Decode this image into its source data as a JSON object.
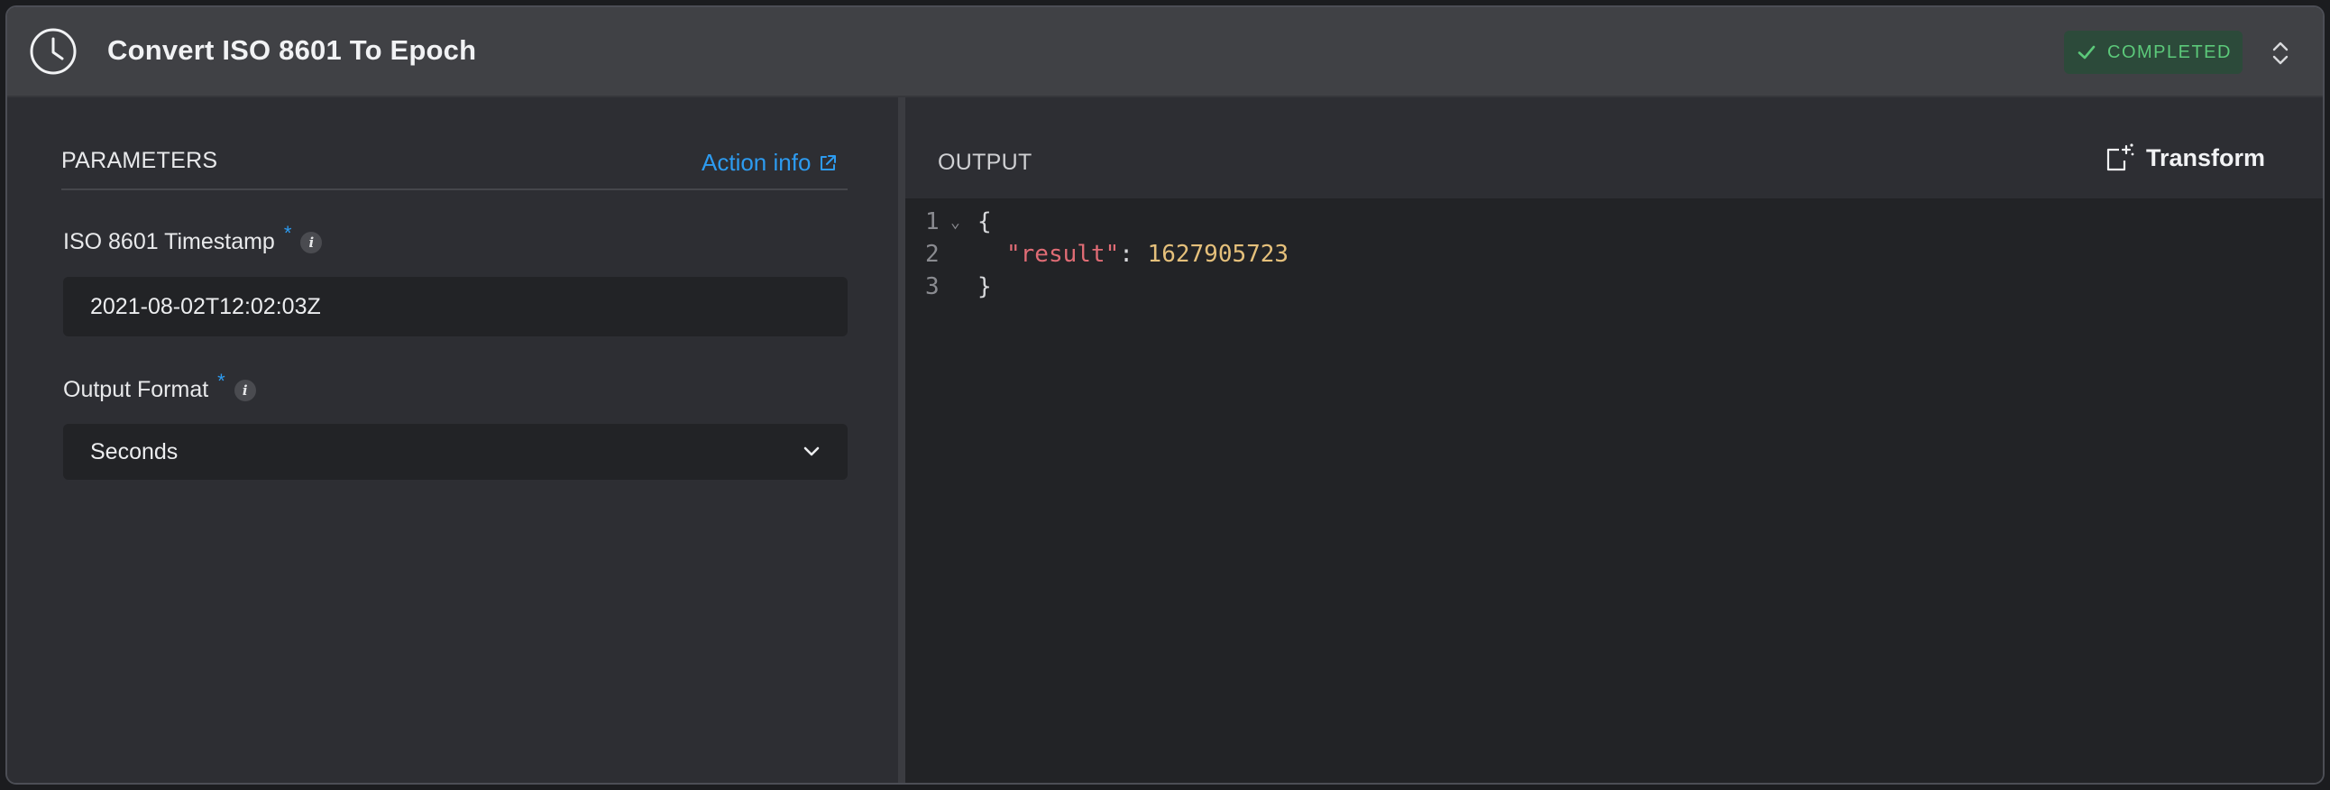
{
  "header": {
    "title": "Convert ISO 8601 To Epoch",
    "status": "COMPLETED"
  },
  "parameters": {
    "heading": "PARAMETERS",
    "action_info": "Action info",
    "fields": [
      {
        "label": "ISO 8601 Timestamp",
        "required_mark": "*",
        "info": "i",
        "value": "2021-08-02T12:02:03Z"
      },
      {
        "label": "Output Format",
        "required_mark": "*",
        "info": "i",
        "value": "Seconds"
      }
    ]
  },
  "output": {
    "heading": "OUTPUT",
    "transform_label": "Transform",
    "lines": [
      {
        "number": "1",
        "open": "{"
      },
      {
        "number": "2",
        "key": "\"result\"",
        "sep": ": ",
        "value": "1627905723"
      },
      {
        "number": "3",
        "close": "}"
      }
    ]
  },
  "colors": {
    "accent": "#2d9bf0",
    "status_green": "#5cc97a",
    "json_key": "#e06c75",
    "json_number": "#e5c07b"
  },
  "icons": [
    "clock-icon",
    "check-icon",
    "expand-collapse-icon",
    "external-link-icon",
    "info-icon",
    "chevron-down-icon",
    "transform-icon",
    "fold-arrow-icon"
  ]
}
